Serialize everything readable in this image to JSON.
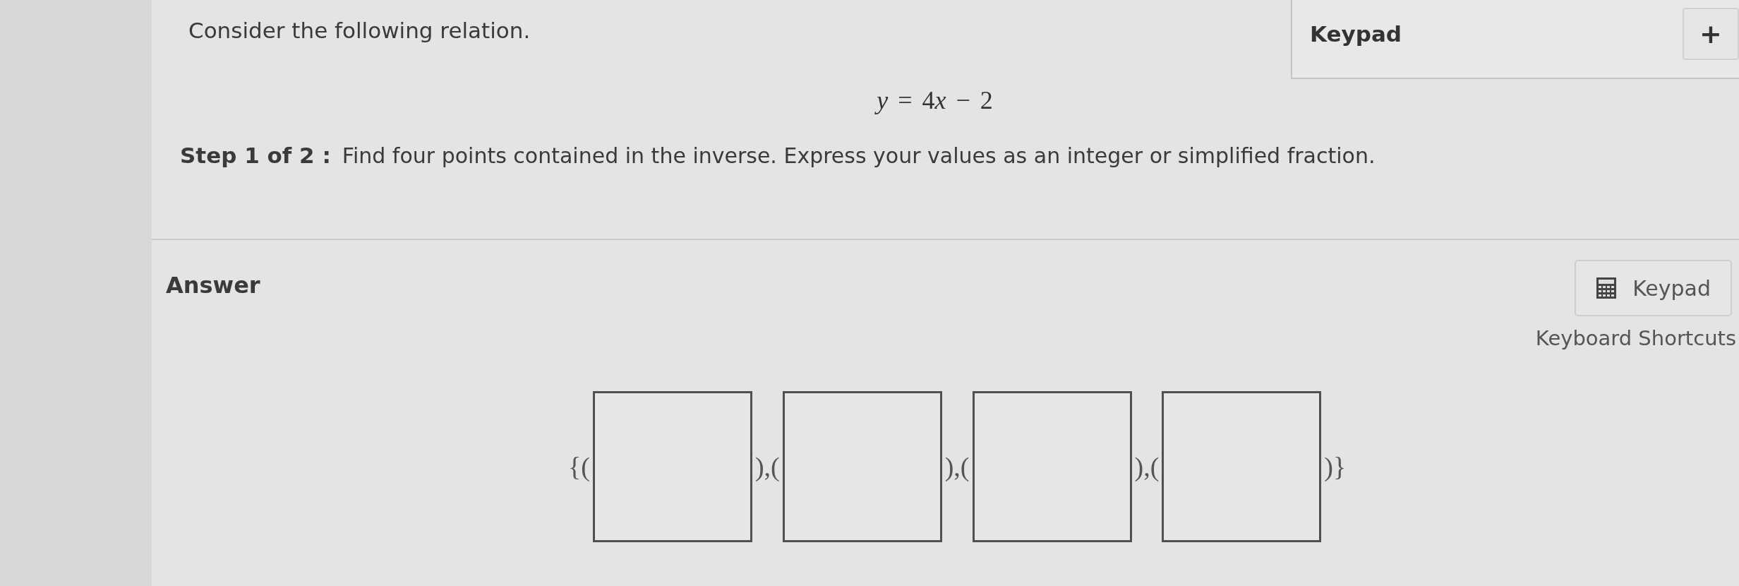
{
  "question": {
    "intro": "Consider the following relation.",
    "equation": [
      {
        "kind": "var",
        "text": "y"
      },
      {
        "kind": "op",
        "text": "="
      },
      {
        "kind": "num",
        "text": "4"
      },
      {
        "kind": "var",
        "text": "x"
      },
      {
        "kind": "op",
        "text": "−"
      },
      {
        "kind": "num",
        "text": "2"
      }
    ],
    "step_label": "Step 1 of 2 :",
    "step_text": "Find four points contained in the inverse. Express your values as an integer or simplified fraction."
  },
  "keypad_panel": {
    "title": "Keypad",
    "expand_button": "+"
  },
  "answer": {
    "label": "Answer",
    "keypad_button": "Keypad",
    "shortcuts_link": "Keyboard Shortcuts",
    "row": [
      {
        "kind": "text",
        "text": "{("
      },
      {
        "kind": "box"
      },
      {
        "kind": "text",
        "text": "),("
      },
      {
        "kind": "box"
      },
      {
        "kind": "text",
        "text": "),("
      },
      {
        "kind": "box"
      },
      {
        "kind": "text",
        "text": "),("
      },
      {
        "kind": "box"
      },
      {
        "kind": "text",
        "text": ")}"
      }
    ]
  }
}
